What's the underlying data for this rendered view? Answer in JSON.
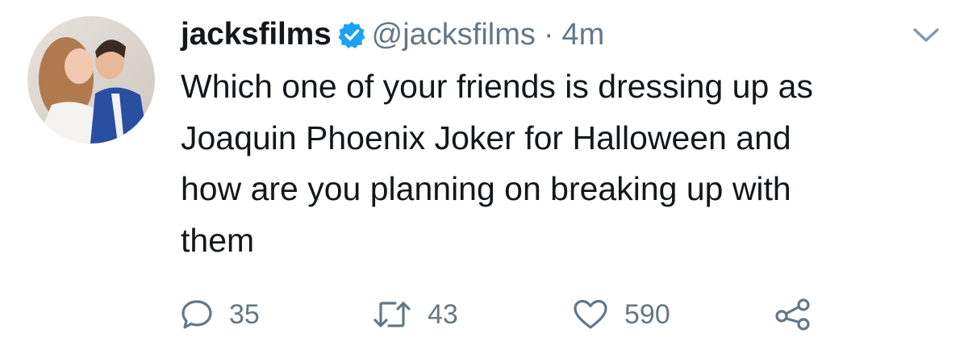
{
  "tweet": {
    "author": {
      "display_name": "jacksfilms",
      "handle": "@jacksfilms",
      "verified": true
    },
    "separator": "·",
    "timestamp": "4m",
    "text_lines": [
      "Which one of your friends is dressing up as",
      "Joaquin Phoenix Joker for Halloween and",
      "how are you planning on breaking up with",
      "them"
    ],
    "actions": {
      "reply_count": "35",
      "retweet_count": "43",
      "like_count": "590"
    }
  },
  "colors": {
    "text": "#14171a",
    "secondary": "#657786",
    "verified_blue": "#1da1f2",
    "background": "#ffffff"
  },
  "icons": {
    "verified": "verified-badge-icon",
    "caret": "chevron-down-icon",
    "reply": "reply-icon",
    "retweet": "retweet-icon",
    "like": "heart-icon",
    "share": "share-icon"
  }
}
